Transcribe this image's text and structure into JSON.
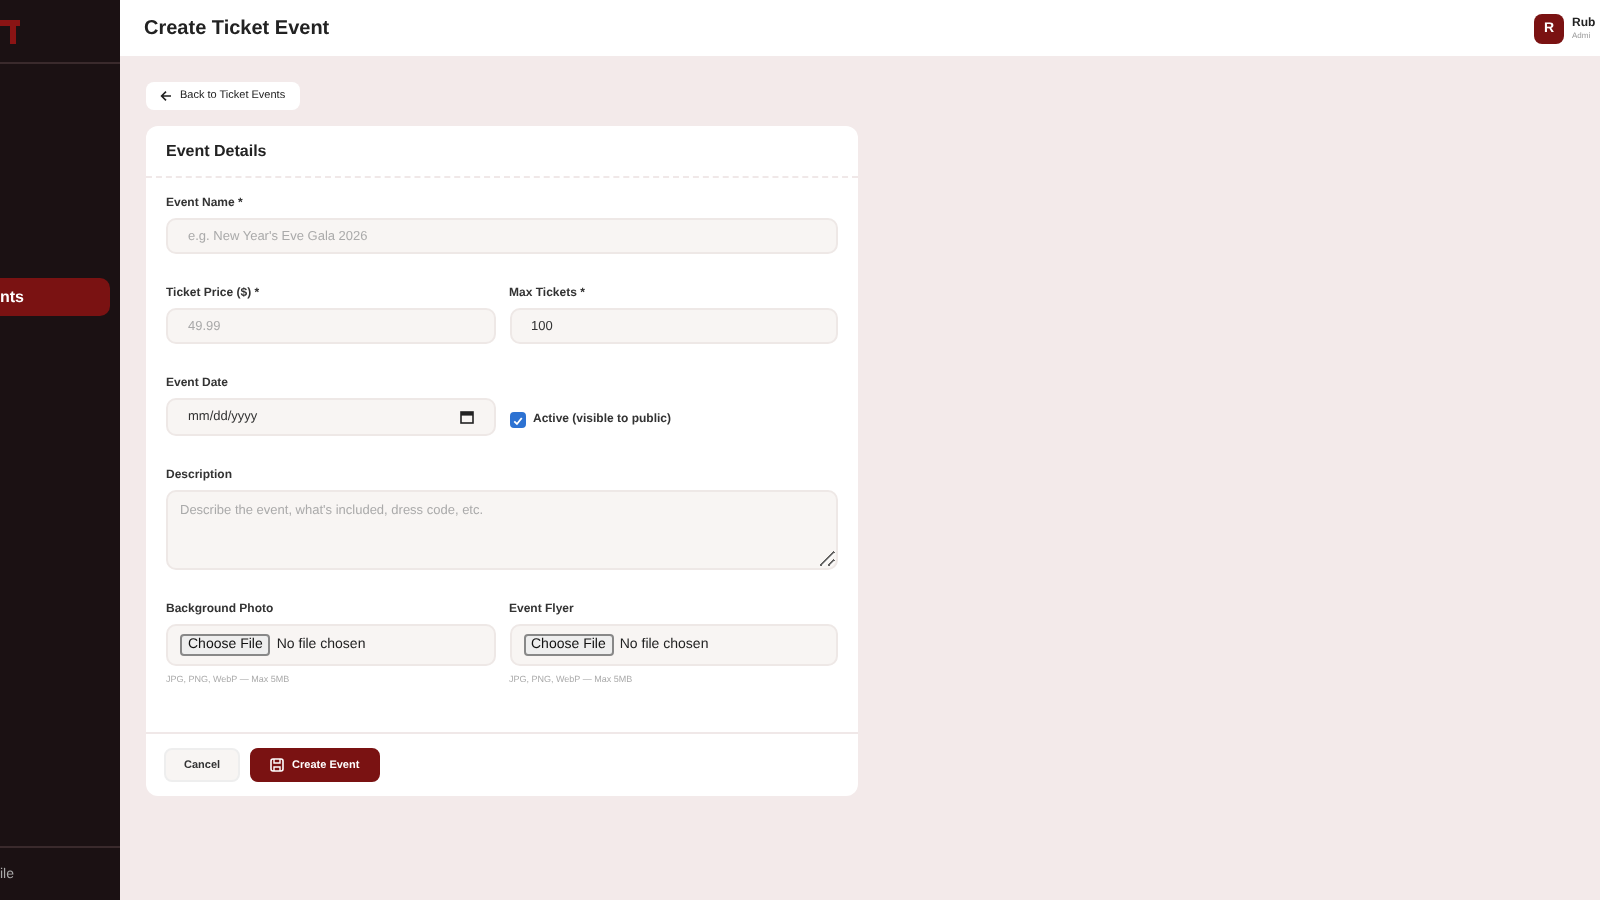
{
  "sidebar": {
    "items": [
      {
        "label": "nts",
        "selected": true
      }
    ],
    "footer": "ile"
  },
  "header": {
    "title": "Create Ticket Event",
    "user": {
      "initial": "R",
      "name": "Rub",
      "role": "Admi"
    }
  },
  "back_link": {
    "label": "Back to Ticket Events"
  },
  "form": {
    "title": "Event Details",
    "rows": [
      [
        {
          "kind": "text",
          "label": "Event Name *",
          "placeholder": "e.g. New Year's Eve Gala 2026"
        }
      ],
      [
        {
          "kind": "text",
          "label": "Ticket Price ($) *",
          "placeholder": "49.99"
        },
        {
          "kind": "text",
          "label": "Max Tickets *",
          "value": "100"
        }
      ],
      [
        {
          "kind": "date",
          "label": "Event Date",
          "value": "mm/dd/yyyy"
        },
        {
          "kind": "checkbox",
          "label": "Active (visible to public)",
          "checked": true
        }
      ],
      [
        {
          "kind": "textarea",
          "label": "Description",
          "placeholder": "Describe the event, what's included, dress code, etc."
        }
      ],
      [
        {
          "kind": "file",
          "label": "Background Photo",
          "button": "Choose File",
          "value": "No file chosen",
          "hint": "JPG, PNG, WebP — Max 5MB"
        },
        {
          "kind": "file",
          "label": "Event Flyer",
          "button": "Choose File",
          "value": "No file chosen",
          "hint": "JPG, PNG, WebP — Max 5MB"
        }
      ]
    ],
    "actions": [
      {
        "kind": "secondary",
        "label": "Cancel"
      },
      {
        "kind": "primary",
        "label": "Create Event"
      }
    ]
  }
}
